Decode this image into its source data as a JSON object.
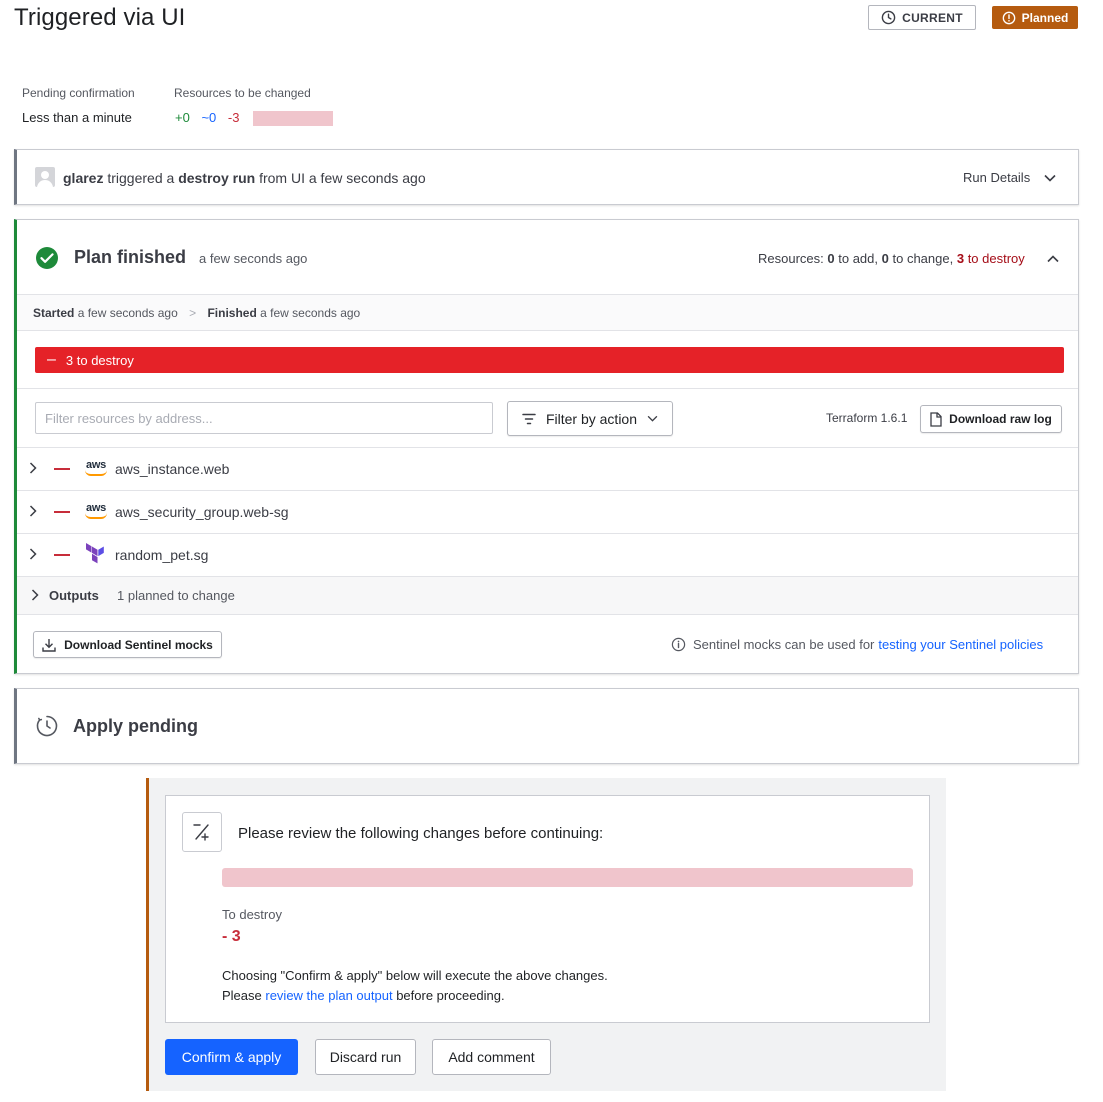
{
  "header": {
    "title": "Triggered via UI",
    "current_badge": "CURRENT",
    "status_badge": "Planned"
  },
  "summary": {
    "pending_label": "Pending confirmation",
    "pending_value": "Less than a minute",
    "resources_label": "Resources to be changed",
    "add": "+0",
    "change": "~0",
    "destroy": "-3"
  },
  "trigger": {
    "user": "glarez",
    "text1": "triggered a",
    "run_type": "destroy run",
    "text2": "from UI a few seconds ago",
    "details_label": "Run Details"
  },
  "plan": {
    "title": "Plan finished",
    "time": "a few seconds ago",
    "resources_prefix": "Resources:",
    "add_count": "0",
    "add_label": "to add,",
    "change_count": "0",
    "change_label": "to change,",
    "destroy_count": "3",
    "destroy_label": "to destroy",
    "started_label": "Started",
    "started_time": "a few seconds ago",
    "finished_label": "Finished",
    "finished_time": "a few seconds ago",
    "destroy_bar": "3 to destroy",
    "filter_placeholder": "Filter resources by address...",
    "filter_action": "Filter by action",
    "terraform_version": "Terraform 1.6.1",
    "download_log": "Download raw log",
    "resources": [
      {
        "name": "aws_instance.web",
        "provider": "aws-logo"
      },
      {
        "name": "aws_security_group.web-sg",
        "provider": "aws-logo"
      },
      {
        "name": "random_pet.sg",
        "provider": "terraform-logo"
      }
    ],
    "outputs_label": "Outputs",
    "outputs_value": "1 planned to change",
    "download_mocks": "Download Sentinel mocks",
    "sentinel_note": "Sentinel mocks can be used for",
    "sentinel_link": "testing your Sentinel policies"
  },
  "apply": {
    "title": "Apply pending"
  },
  "review": {
    "heading": "Please review the following changes before continuing:",
    "destroy_label": "To destroy",
    "destroy_value": "- 3",
    "note1": "Choosing \"Confirm & apply\" below will execute the above changes.",
    "note2_prefix": "Please",
    "note2_link": "review the plan output",
    "note2_suffix": "before proceeding.",
    "confirm": "Confirm & apply",
    "discard": "Discard run",
    "comment": "Add comment"
  },
  "colors": {
    "accent": "#1563ff",
    "success": "#1e8a3a",
    "danger": "#e52228",
    "warning": "#b55b0f"
  }
}
